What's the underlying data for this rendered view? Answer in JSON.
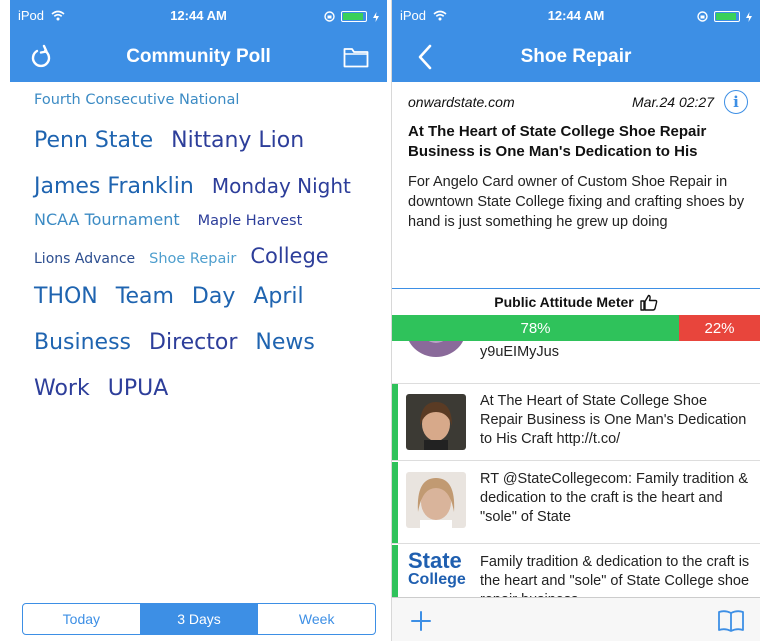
{
  "left": {
    "status": {
      "carrier": "iPod",
      "time": "12:44 AM"
    },
    "nav": {
      "title": "Community Poll",
      "left_icon": "refresh-icon",
      "right_icon": "folder-icon"
    },
    "cloud": {
      "w1": "Fourth Consecutive National",
      "w2": "Penn State",
      "w3": "Nittany Lion",
      "w4": "James Franklin",
      "w5": "Monday Night",
      "w6": "NCAA Tournament",
      "w7": "Maple Harvest",
      "w8": "Lions Advance",
      "w9": "Shoe Repair",
      "w10": "College",
      "w11": "THON",
      "w12": "Team",
      "w13": "Day",
      "w14": "April",
      "w15": "Business",
      "w16": "Director",
      "w17": "News",
      "w18": "Work",
      "w19": "UPUA"
    },
    "segments": {
      "s1": "Today",
      "s2": "3 Days",
      "s3": "Week",
      "selected": "3 Days"
    }
  },
  "right": {
    "status": {
      "carrier": "iPod",
      "time": "12:44 AM"
    },
    "nav": {
      "title": "Shoe Repair",
      "back_icon": "back-chevron-icon"
    },
    "article": {
      "source": "onwardstate.com",
      "date": "Mar.24 02:27",
      "info_icon": "info-icon",
      "title": "At The Heart of State College Shoe Repair Business is One Man's Dedication to His",
      "body": "For Angelo Card owner of Custom Shoe Repair in downtown State College fixing and crafting shoes by hand is just something he grew up doing"
    },
    "meter": {
      "label": "Public Attitude Meter",
      "icon": "thumbs-up-icon",
      "positive_pct": 78,
      "negative_pct": 22,
      "positive_label": "78%",
      "negative_label": "22%",
      "positive_color": "#2fc25b",
      "negative_color": "#e8453c"
    },
    "feed": {
      "partial_text": "y9uEIMyJus",
      "items": [
        {
          "text": "At The Heart of State College Shoe Repair Business is One Man's Dedication to His Craft http://t.co/"
        },
        {
          "text": "RT @StateCollegecom: Family tradition & dedication to the craft is the heart and \"sole\" of State"
        },
        {
          "text": "Family tradition & dedication to the craft is the heart and \"sole\" of State College shoe repair business",
          "logo_line1": "State",
          "logo_line2": "College"
        }
      ]
    },
    "toolbar": {
      "left_icon": "plus-icon",
      "right_icon": "book-icon"
    }
  },
  "colors": {
    "accent": "#3d8fe5",
    "positive": "#2fc25b",
    "negative": "#e8453c"
  }
}
